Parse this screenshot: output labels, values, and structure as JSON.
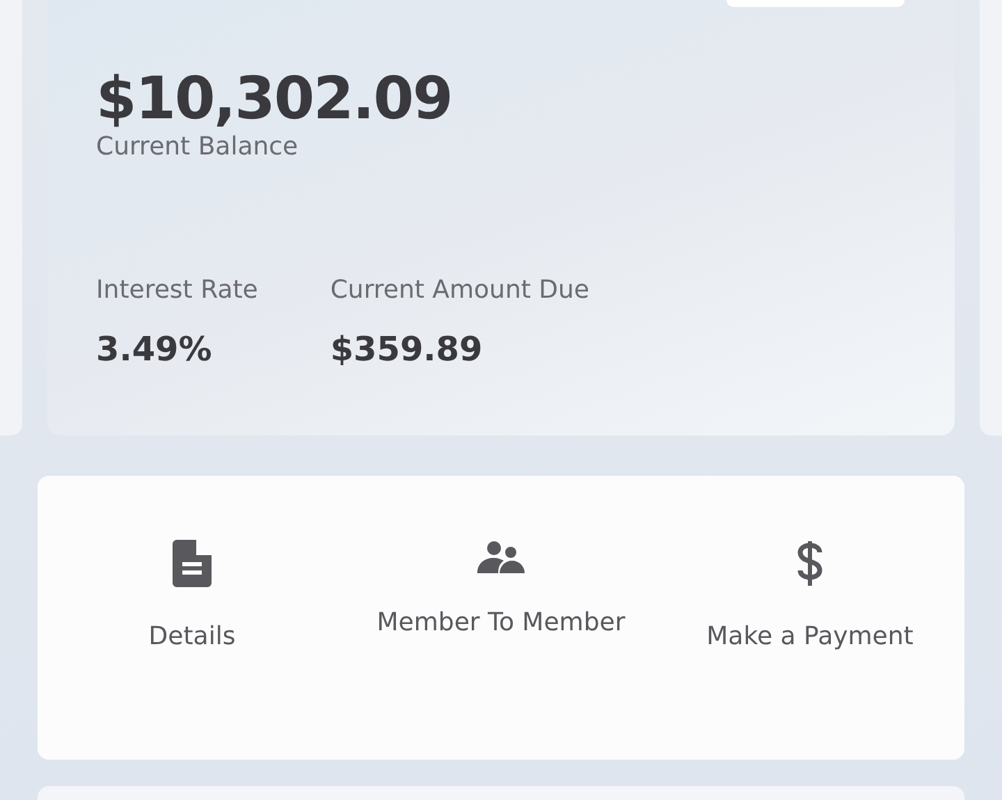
{
  "account": {
    "balance": "$10,302.09",
    "balance_label": "Current Balance",
    "stats": [
      {
        "label": "Interest Rate",
        "value": "3.49%"
      },
      {
        "label": "Current Amount Due",
        "value": "$359.89"
      }
    ]
  },
  "actions": [
    {
      "kind": "document",
      "label": "Details"
    },
    {
      "kind": "people",
      "label": "Member To Member"
    },
    {
      "kind": "dollar",
      "label": "Make a Payment"
    }
  ]
}
